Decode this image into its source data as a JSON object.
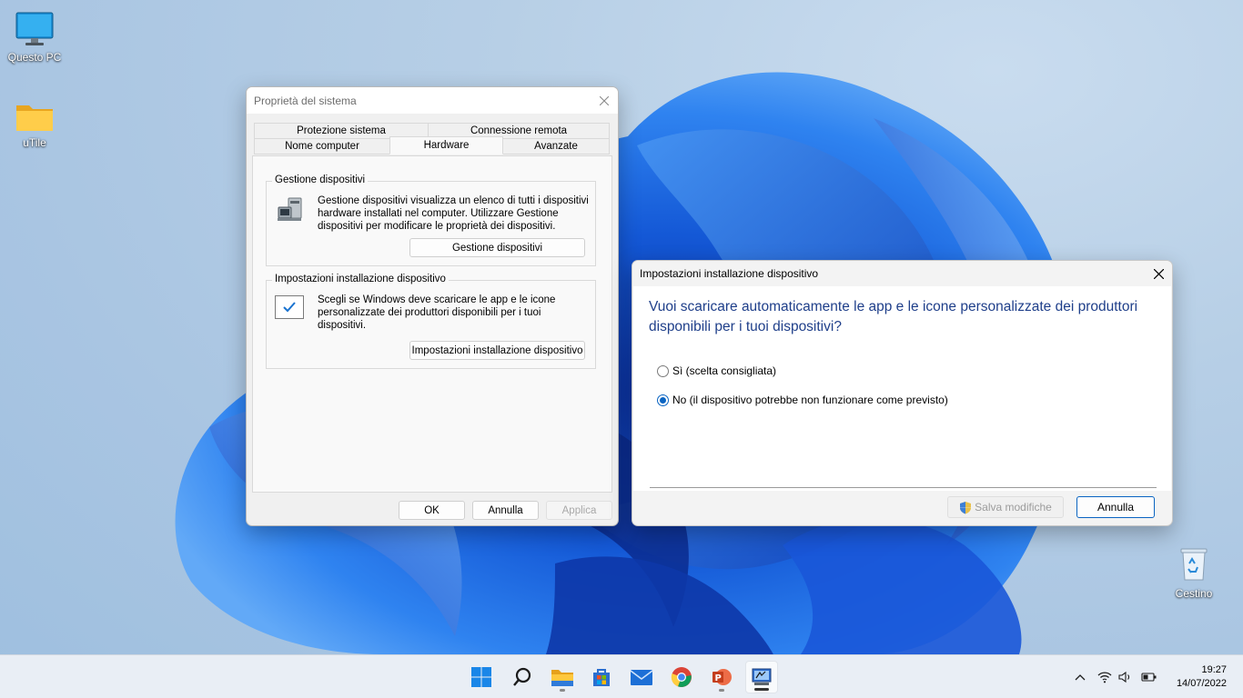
{
  "desktop": {
    "icons": [
      {
        "label": "Questo PC"
      },
      {
        "label": "uTile"
      },
      {
        "label": "Cestino"
      }
    ]
  },
  "system_properties": {
    "title": "Proprietà del sistema",
    "tabs": [
      "Protezione sistema",
      "Connessione remota",
      "Nome computer",
      "Hardware",
      "Avanzate"
    ],
    "active_tab": "Hardware",
    "device_manager_group": {
      "title": "Gestione dispositivi",
      "text": "Gestione dispositivi visualizza un elenco di tutti i dispositivi hardware installati nel computer. Utilizzare Gestione dispositivi per modificare le proprietà dei dispositivi.",
      "button": "Gestione dispositivi"
    },
    "device_install_group": {
      "title": "Impostazioni installazione dispositivo",
      "text": "Scegli se Windows deve scaricare le app e le icone personalizzate dei produttori disponibili per i tuoi dispositivi.",
      "button": "Impostazioni installazione dispositivo"
    },
    "buttons": {
      "ok": "OK",
      "cancel": "Annulla",
      "apply": "Applica"
    }
  },
  "device_install_dialog": {
    "title": "Impostazioni installazione dispositivo",
    "question": "Vuoi scaricare automaticamente le app e le icone personalizzate dei produttori disponibili per i tuoi dispositivi?",
    "options": [
      {
        "label": "Sì (scelta consigliata)",
        "selected": false
      },
      {
        "label": "No (il dispositivo potrebbe non funzionare come previsto)",
        "selected": true
      }
    ],
    "save_label": "Salva modifiche",
    "cancel_label": "Annulla"
  },
  "taskbar": {
    "apps": [
      "start-icon",
      "search-icon",
      "file-explorer-icon",
      "store-icon",
      "mail-icon",
      "chrome-icon",
      "powerpoint-icon",
      "system-properties-icon"
    ],
    "time": "19:27",
    "date": "14/07/2022"
  },
  "colors": {
    "accent": "#0a64c2",
    "question_text": "#1f3f8a",
    "wallpaper_blue": "#1565e0"
  }
}
